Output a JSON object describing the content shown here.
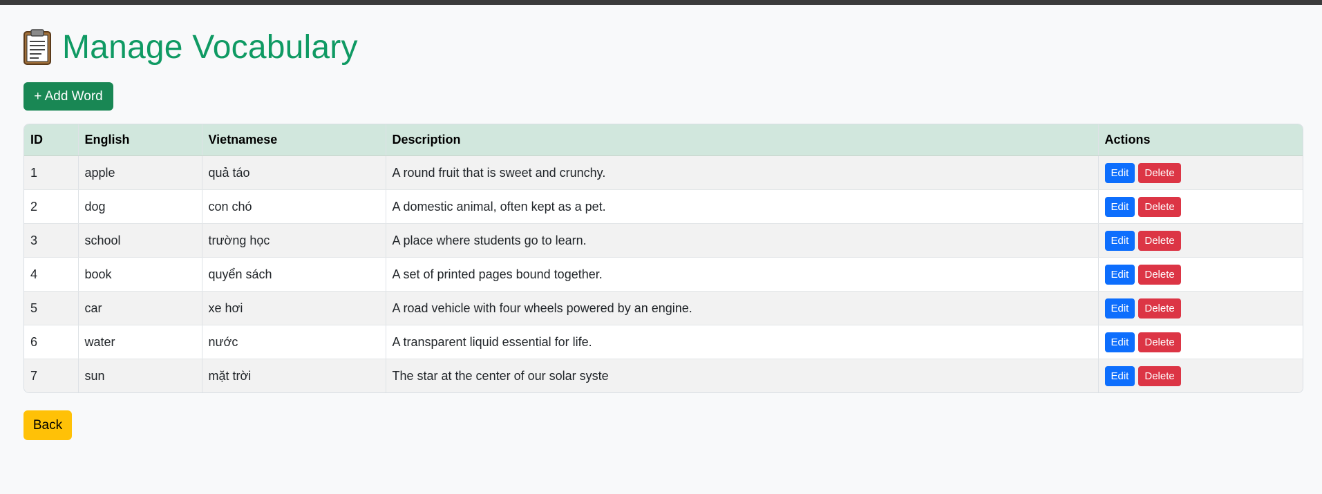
{
  "page": {
    "title": "Manage Vocabulary",
    "title_icon": "clipboard-icon",
    "add_button_label": "+ Add Word",
    "back_button_label": "Back"
  },
  "colors": {
    "title": "#0f9a63",
    "add_button": "#198754",
    "table_header": "#d1e7dd",
    "edit_button": "#0d6efd",
    "delete_button": "#dc3545",
    "back_button": "#ffc107"
  },
  "table": {
    "headers": [
      "ID",
      "English",
      "Vietnamese",
      "Description",
      "Actions"
    ],
    "edit_label": "Edit",
    "delete_label": "Delete",
    "rows": [
      {
        "id": "1",
        "english": "apple",
        "vietnamese": "quả táo",
        "description": "A round fruit that is sweet and crunchy."
      },
      {
        "id": "2",
        "english": "dog",
        "vietnamese": "con chó",
        "description": "A domestic animal, often kept as a pet."
      },
      {
        "id": "3",
        "english": "school",
        "vietnamese": "trường học",
        "description": "A place where students go to learn."
      },
      {
        "id": "4",
        "english": "book",
        "vietnamese": "quyển sách",
        "description": "A set of printed pages bound together."
      },
      {
        "id": "5",
        "english": "car",
        "vietnamese": "xe hơi",
        "description": "A road vehicle with four wheels powered by an engine."
      },
      {
        "id": "6",
        "english": "water",
        "vietnamese": "nước",
        "description": "A transparent liquid essential for life."
      },
      {
        "id": "7",
        "english": "sun",
        "vietnamese": "mặt trời",
        "description": "The star at the center of our solar syste"
      }
    ]
  }
}
